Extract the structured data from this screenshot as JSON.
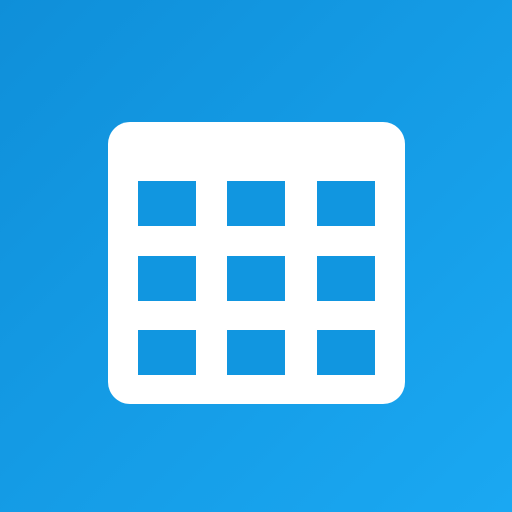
{
  "app_icon": {
    "icon": "calendar-grid-icon",
    "rows": 3,
    "columns": 3,
    "colors": {
      "background_start": "#0f8fd9",
      "background_end": "#1aa8f2",
      "calendar_body": "#ffffff",
      "grid_cell": "#1196e0"
    }
  }
}
